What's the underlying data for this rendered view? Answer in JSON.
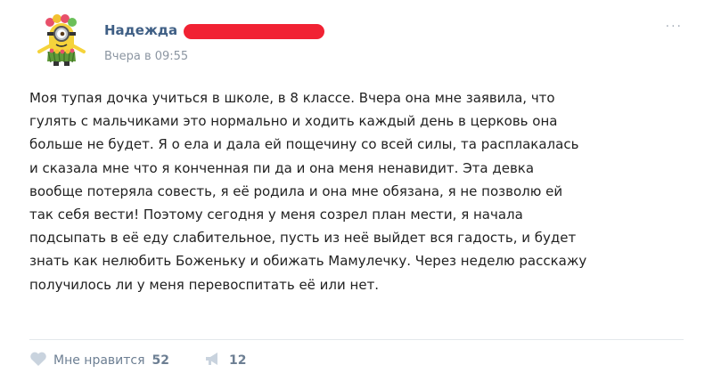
{
  "post": {
    "author": "Надежда",
    "time": "Вчера в 09:55",
    "more": "···",
    "lines": [
      "Моя тупая дочка учиться в школе, в 8 классе. Вчера она мне заявила, что",
      "гулять с мальчиками это нормально и ходить каждый день в церковь она",
      "больше не будет. Я о   ела и дала ей пощечину со всей силы, та расплакалась",
      "и сказала мне что я конченная пи   да и она меня ненавидит. Эта девка",
      "вообще потеряла совесть, я её родила и она мне обязана, я не позволю ей",
      "так себя вести! Поэтому сегодня у меня созрел план мести, я начала",
      "подсыпать в её еду слабительное, пусть из неё выйдет вся гадость, и будет",
      "знать как нелюбить Боженьку и обижать Мамулечку. Через неделю расскажу",
      "получилось ли у меня перевоспитать её или нет."
    ]
  },
  "actions": {
    "like_label": "Мне нравится",
    "like_count": "52",
    "share_count": "12"
  },
  "colors": {
    "author": "#3f5f85",
    "meta": "#8c96a2",
    "action": "#6d7f93",
    "redaction": "#f12233"
  }
}
